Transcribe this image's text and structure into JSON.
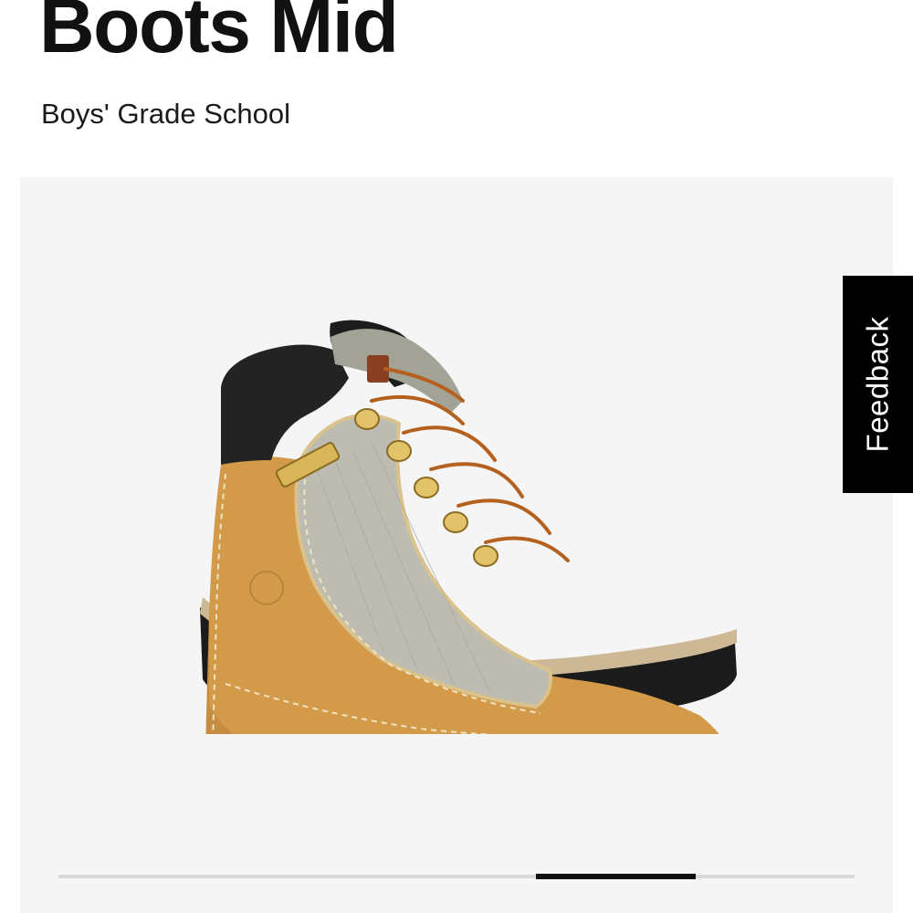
{
  "product": {
    "title": "Boots Mid",
    "subtitle": "Boys' Grade School"
  },
  "gallery": {
    "image_alt": "Timberland field boot, wheat nubuck with black padded collar and gold hooks",
    "slide_position_fraction": 0.75,
    "slide_count": 5,
    "current_slide": 4
  },
  "feedback": {
    "label": "Feedback"
  },
  "colors": {
    "gallery_background": "#f5f5f5",
    "feedback_background": "#000000",
    "feedback_text": "#ffffff",
    "progress_track": "#d9d9d9",
    "progress_thumb": "#111111",
    "boot_nubuck": "#d39a4a",
    "boot_mesh": "#bdbcb2",
    "boot_collar": "#202020",
    "boot_sole": "#1a1a1a"
  }
}
